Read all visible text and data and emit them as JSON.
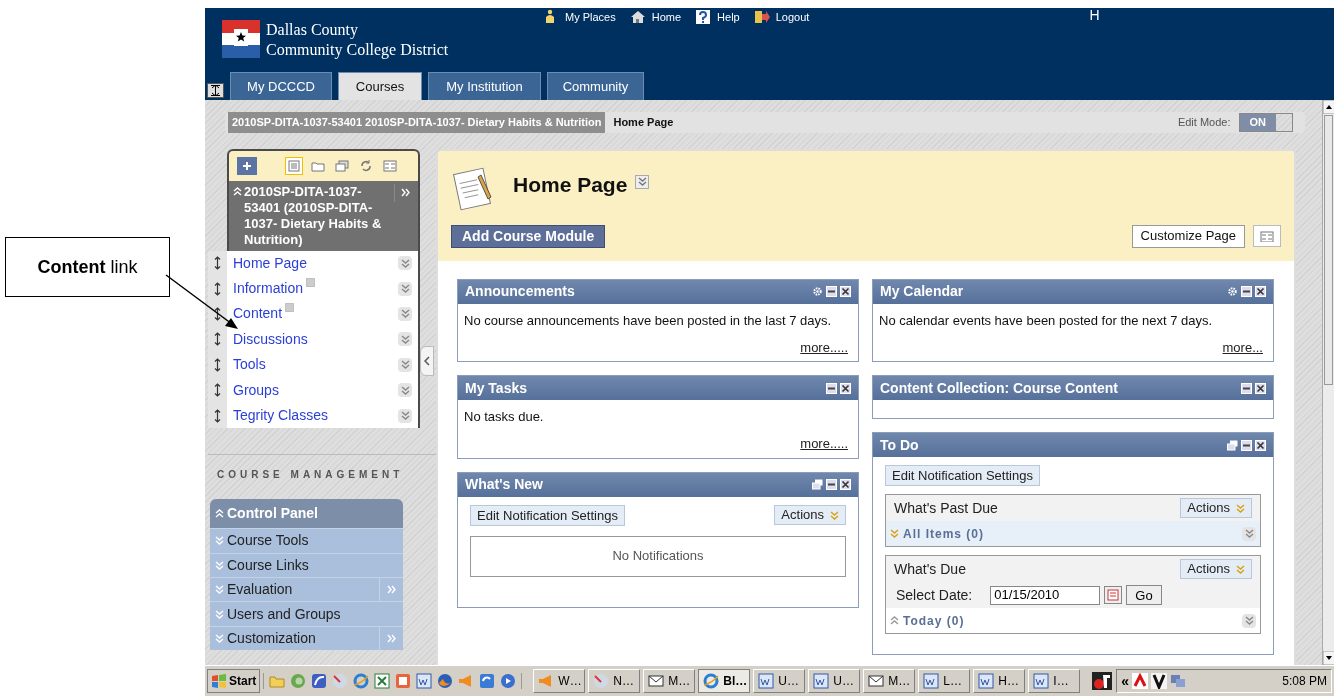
{
  "callout": {
    "label": "**Content** link"
  },
  "header": {
    "institution_lines": [
      "Dallas County",
      "Community College District"
    ],
    "top_links": [
      {
        "kind": "places",
        "label": "My Places"
      },
      {
        "kind": "home",
        "label": "Home"
      },
      {
        "kind": "help",
        "label": "Help"
      },
      {
        "kind": "logout",
        "label": "Logout"
      }
    ],
    "user_initial": "H"
  },
  "tabs": [
    {
      "label": "My DCCCD",
      "selected": false
    },
    {
      "label": "Courses",
      "selected": true
    },
    {
      "label": "My Institution",
      "selected": false
    },
    {
      "label": "Community",
      "selected": false
    }
  ],
  "breadcrumb": {
    "course": "2010SP-DITA-1037-53401 2010SP-DITA-1037- Dietary Habits & Nutrition",
    "page": "Home Page"
  },
  "edit_mode": {
    "label": "Edit Mode:",
    "value": "ON"
  },
  "course_menu": {
    "view_buttons": [
      {
        "kind": "list",
        "selected": true
      },
      {
        "kind": "folder",
        "selected": false
      },
      {
        "kind": "windows",
        "selected": false
      },
      {
        "kind": "refresh",
        "selected": false
      },
      {
        "kind": "grid",
        "selected": false
      }
    ],
    "title": "2010SP-DITA-1037-53401 (2010SP-DITA-1037- Dietary Habits & Nutrition)",
    "items": [
      {
        "label": "Home Page",
        "hidden": false
      },
      {
        "label": "Information",
        "hidden": true
      },
      {
        "label": "Content",
        "hidden": true
      },
      {
        "label": "Discussions",
        "hidden": false
      },
      {
        "label": "Tools",
        "hidden": false
      },
      {
        "label": "Groups",
        "hidden": false
      },
      {
        "label": "Tegrity Classes",
        "hidden": false
      }
    ]
  },
  "management": {
    "heading": "COURSE MANAGEMENT",
    "items": [
      {
        "kind": "header",
        "label": "Control Panel",
        "flyout": false
      },
      {
        "kind": "item",
        "label": "Course Tools",
        "flyout": false
      },
      {
        "kind": "item",
        "label": "Course Links",
        "flyout": false
      },
      {
        "kind": "item",
        "label": "Evaluation",
        "flyout": true
      },
      {
        "kind": "item",
        "label": "Users and Groups",
        "flyout": false
      },
      {
        "kind": "item",
        "label": "Customization",
        "flyout": true
      }
    ]
  },
  "page": {
    "title": "Home Page",
    "add_button": "Add Course Module",
    "customize_button": "Customize Page"
  },
  "modules": {
    "left": [
      {
        "kind": "text",
        "title": "Announcements",
        "controls": [
          {
            "kind": "settings"
          },
          {
            "kind": "minimize"
          },
          {
            "kind": "close"
          }
        ],
        "body": "No course announcements have been posted in the last 7 days.",
        "more": "more....."
      },
      {
        "kind": "text",
        "title": "My Tasks",
        "controls": [
          {
            "kind": "minimize"
          },
          {
            "kind": "close"
          }
        ],
        "body": "No tasks due.",
        "more": "more....."
      },
      {
        "kind": "notifications",
        "title": "What's New",
        "controls": [
          {
            "kind": "popout"
          },
          {
            "kind": "minimize"
          },
          {
            "kind": "close"
          }
        ],
        "edit_button": "Edit Notification Settings",
        "actions": "Actions",
        "empty_text": "No Notifications"
      }
    ],
    "right": [
      {
        "kind": "text",
        "title": "My Calendar",
        "controls": [
          {
            "kind": "settings"
          },
          {
            "kind": "minimize"
          },
          {
            "kind": "close"
          }
        ],
        "body": "No calendar events have been posted for the next 7 days.",
        "more": "more..."
      },
      {
        "kind": "empty",
        "title": "Content Collection: Course Content",
        "controls": [
          {
            "kind": "minimize"
          },
          {
            "kind": "close"
          }
        ]
      },
      {
        "kind": "todo",
        "title": "To Do",
        "controls": [
          {
            "kind": "popout"
          },
          {
            "kind": "minimize"
          },
          {
            "kind": "close"
          }
        ],
        "edit_button": "Edit Notification Settings",
        "sections": [
          {
            "title": "What's Past Due",
            "actions": "Actions",
            "rows": [
              {
                "label": "All Items (0)",
                "expanded": false
              }
            ]
          },
          {
            "title": "What's Due",
            "actions": "Actions",
            "date_label": "Select Date:",
            "date_value": "01/15/2010",
            "go": "Go",
            "rows": [
              {
                "label": "Today (0)",
                "expanded": true
              }
            ]
          }
        ]
      }
    ]
  },
  "taskbar": {
    "start": "Start",
    "windows": [
      {
        "kind": "speaker",
        "label": "W…",
        "selected": false
      },
      {
        "kind": "globe",
        "label": "N…",
        "selected": false
      },
      {
        "kind": "mail",
        "label": "M…",
        "selected": false
      },
      {
        "kind": "browser",
        "label": "Bl…",
        "selected": true
      },
      {
        "kind": "document",
        "label": "U…",
        "selected": false
      },
      {
        "kind": "document",
        "label": "U…",
        "selected": false
      },
      {
        "kind": "mail",
        "label": "M…",
        "selected": false
      },
      {
        "kind": "document",
        "label": "L…",
        "selected": false
      },
      {
        "kind": "document",
        "label": "H…",
        "selected": false
      },
      {
        "kind": "document",
        "label": "I…",
        "selected": false
      }
    ],
    "tray_toggle": "«",
    "clock": "5:08 PM"
  }
}
